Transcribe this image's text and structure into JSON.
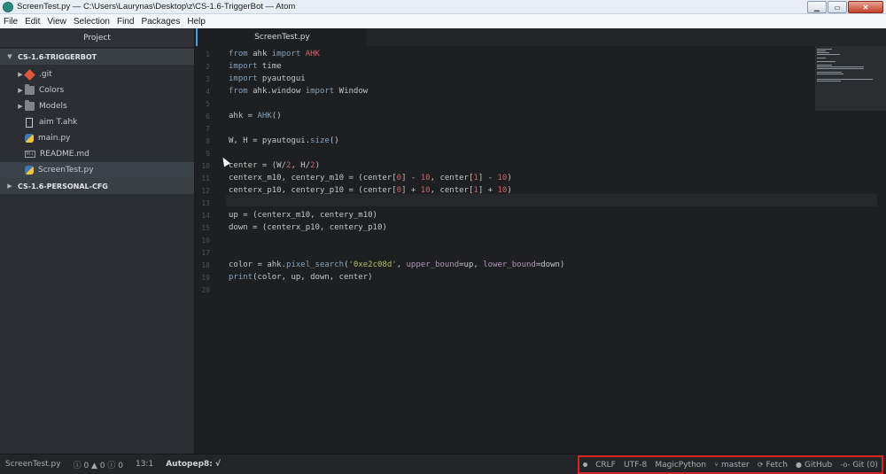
{
  "window": {
    "title": "ScreenTest.py — C:\\Users\\Laurynas\\Desktop\\z\\CS-1.6-TriggerBot — Atom",
    "controls": {
      "minimize": "▁",
      "maximize": "▭",
      "close": "✕"
    }
  },
  "menu": [
    "File",
    "Edit",
    "View",
    "Selection",
    "Find",
    "Packages",
    "Help"
  ],
  "tree": {
    "header": "Project",
    "projects": [
      {
        "name": "CS-1.6-TRIGGERBOT",
        "items": [
          {
            "label": ".git",
            "icon": "git-icon"
          },
          {
            "label": "Colors",
            "icon": "folder-icon"
          },
          {
            "label": "Models",
            "icon": "folder-icon"
          },
          {
            "label": "aim T.ahk",
            "icon": "file-icon"
          },
          {
            "label": "main.py",
            "icon": "python-icon"
          },
          {
            "label": "README.md",
            "icon": "markdown-icon"
          },
          {
            "label": "ScreenTest.py",
            "icon": "python-icon"
          }
        ]
      },
      {
        "name": "CS-1.6-PERSONAL-CFG"
      }
    ]
  },
  "editor": {
    "tab": "ScreenTest.py",
    "line_numbers": [
      "1",
      "2",
      "3",
      "4",
      "5",
      "6",
      "7",
      "8",
      "9",
      "10",
      "11",
      "12",
      "13",
      "14",
      "15",
      "16",
      "17",
      "18",
      "19",
      "20"
    ],
    "lines": [
      "from ahk import AHK",
      "import time",
      "import pyautogui",
      "from ahk.window import Window",
      "",
      "ahk = AHK()",
      "",
      "W, H = pyautogui.size()",
      "",
      "center = (W/2, H/2)",
      "centerx_m10, centery_m10 = (center[0] - 10, center[1] - 10)",
      "centerx_p10, centery_p10 = (center[0] + 10, center[1] + 10)",
      "",
      "up = (centerx_m10, centery_m10)",
      "down = (centerx_p10, centery_p10)",
      "",
      "",
      "color = ahk.pixel_search('0xe2c08d', upper_bound=up, lower_bound=down)",
      "print(color, up, down, center)",
      ""
    ]
  },
  "status": {
    "file": "ScreenTest.py",
    "diagnostics": "ⓘ 0 ▲ 0 ⓘ 0",
    "cursor": "13:1",
    "autopep8": "Autopep8: √",
    "line_ending": "CRLF",
    "encoding": "UTF-8",
    "grammar": "MagicPython",
    "branch": "master",
    "fetch": "Fetch",
    "github": "GitHub",
    "git": "Git (0)"
  }
}
